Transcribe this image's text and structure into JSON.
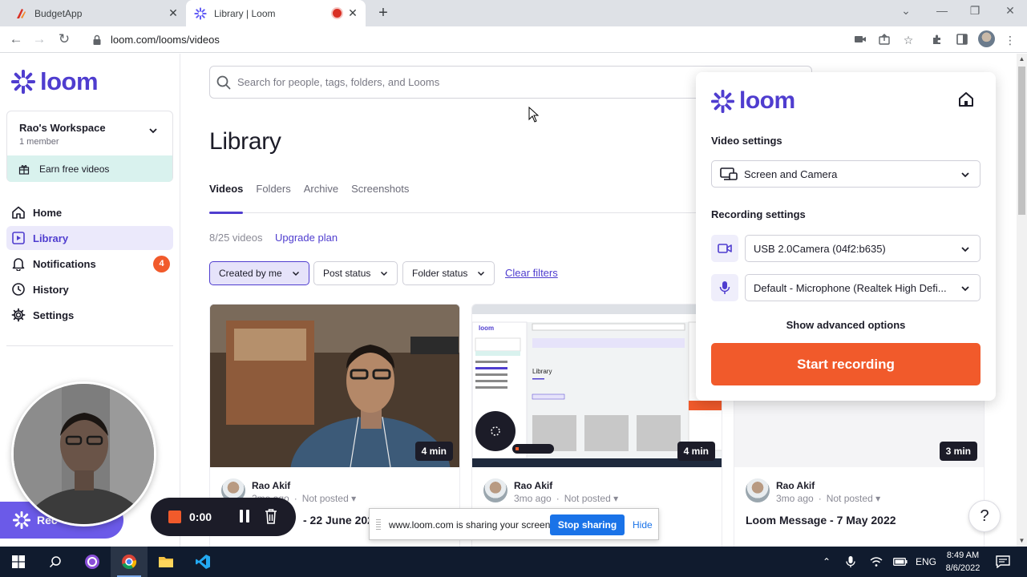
{
  "browser": {
    "tabs": [
      {
        "title": "BudgetApp"
      },
      {
        "title": "Library | Loom"
      }
    ],
    "url": "loom.com/looms/videos"
  },
  "sidebar": {
    "brand": "loom",
    "workspace": {
      "name": "Rao's Workspace",
      "members": "1 member",
      "promo": "Earn free videos"
    },
    "items": [
      {
        "label": "Home",
        "icon": "home-icon"
      },
      {
        "label": "Library",
        "icon": "library-icon",
        "active": true
      },
      {
        "label": "Notifications",
        "icon": "bell-icon",
        "badge": "4"
      },
      {
        "label": "History",
        "icon": "clock-icon"
      },
      {
        "label": "Settings",
        "icon": "gear-icon"
      }
    ]
  },
  "main": {
    "search_placeholder": "Search for people, tags, folders, and Looms",
    "title": "Library",
    "tabs": [
      "Videos",
      "Folders",
      "Archive",
      "Screenshots"
    ],
    "count": "8/25 videos",
    "upgrade": "Upgrade plan",
    "filters": [
      "Created by me",
      "Post status",
      "Folder status"
    ],
    "clear": "Clear filters",
    "cards": [
      {
        "duration": "4 min",
        "author": "Rao Akif",
        "age": "2mo ago",
        "status": "Not posted",
        "title": "- 22 June 2022"
      },
      {
        "duration": "4 min",
        "author": "Rao Akif",
        "age": "3mo ago",
        "status": "Not posted",
        "title": ""
      },
      {
        "duration": "3 min",
        "author": "Rao Akif",
        "age": "3mo ago",
        "status": "Not posted",
        "title": "Loom Message - 7 May 2022"
      }
    ]
  },
  "popup": {
    "brand": "loom",
    "video_settings": "Video settings",
    "video_mode": "Screen and Camera",
    "recording_settings": "Recording settings",
    "camera": "USB 2.0Camera (04f2:b635)",
    "microphone": "Default - Microphone (Realtek High Defi...",
    "advanced": "Show advanced options",
    "start": "Start recording"
  },
  "recorder": {
    "timer": "0:00",
    "pill_label": "Rec"
  },
  "sharing": {
    "message": "www.loom.com is sharing your screen.",
    "stop": "Stop sharing",
    "hide": "Hide"
  },
  "help": "?",
  "taskbar": {
    "lang": "ENG",
    "time": "8:49 AM",
    "date": "8/6/2022"
  },
  "colors": {
    "brand": "#4f3dcf",
    "accent": "#f15a2b",
    "chrome_blue": "#1a73e8"
  }
}
